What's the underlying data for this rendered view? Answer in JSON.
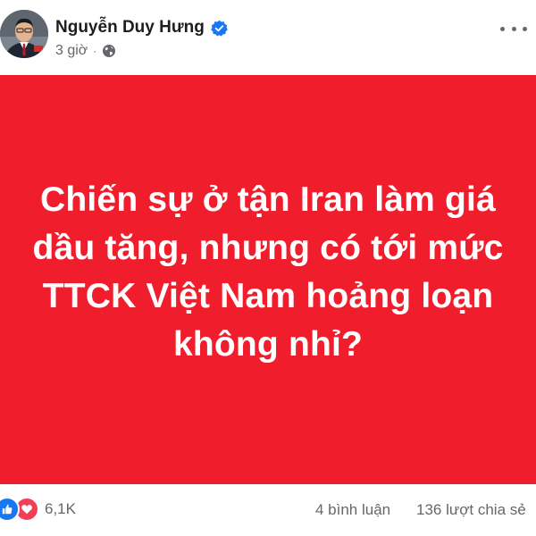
{
  "post": {
    "author": "Nguyễn Duy Hưng",
    "time": "3 giờ",
    "separator": "·",
    "privacy_icon": "globe-icon",
    "verified_icon": "verified-badge-icon",
    "image_text_lines": [
      "Chiến sự ở tận Iran làm giá",
      "dầu tăng, nhưng có tới mức",
      "TTCK Việt Nam hoảng loạn",
      "không nhỉ?"
    ],
    "image_bg": "#f01e2c"
  },
  "footer": {
    "reaction_count": "6,1K",
    "comments": "4 bình luận",
    "shares": "136 lượt chia sẻ"
  },
  "colors": {
    "accent_blue": "#1877f2",
    "love_red": "#f33e58",
    "muted_text": "#65676b"
  }
}
